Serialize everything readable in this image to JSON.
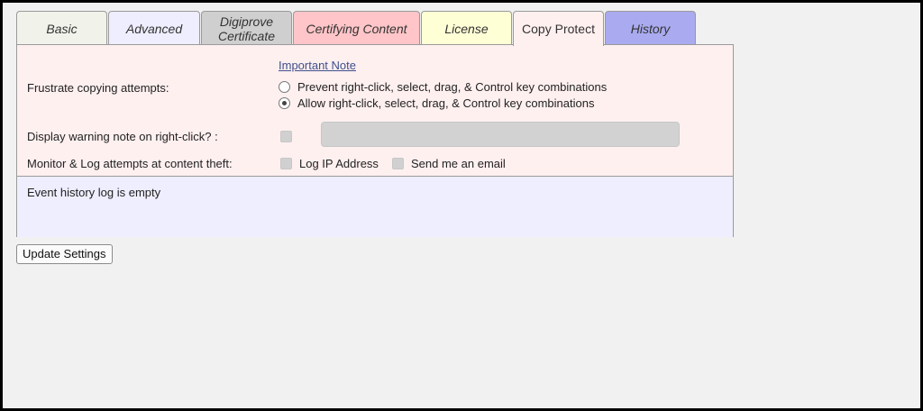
{
  "tabs": [
    {
      "label": "Basic",
      "color": "#f1f2ea"
    },
    {
      "label": "Advanced",
      "color": "#eeeeff"
    },
    {
      "label": "Digiprove\nCertificate",
      "color": "#cfcfcf"
    },
    {
      "label": "Certifying Content",
      "color": "#ffc5c8"
    },
    {
      "label": "License",
      "color": "#ffffd6"
    },
    {
      "label": "Copy Protect",
      "color": "#fff0f0",
      "active": true
    },
    {
      "label": "History",
      "color": "#aaaaf0"
    }
  ],
  "copy_protect": {
    "important_note": "Important Note",
    "frustrate_label": "Frustrate copying attempts:",
    "radio_prevent": "Prevent right-click, select, drag, & Control key combinations",
    "radio_allow": "Allow right-click, select, drag, & Control key combinations",
    "radio_selected": "allow",
    "warning_label": "Display warning note on right-click? :",
    "warning_text_value": "",
    "monitor_label": "Monitor & Log attempts at content theft:",
    "log_ip_label": "Log IP Address",
    "email_label": "Send me an email"
  },
  "history": {
    "empty_text": "Event history log is empty"
  },
  "buttons": {
    "update": "Update Settings"
  }
}
